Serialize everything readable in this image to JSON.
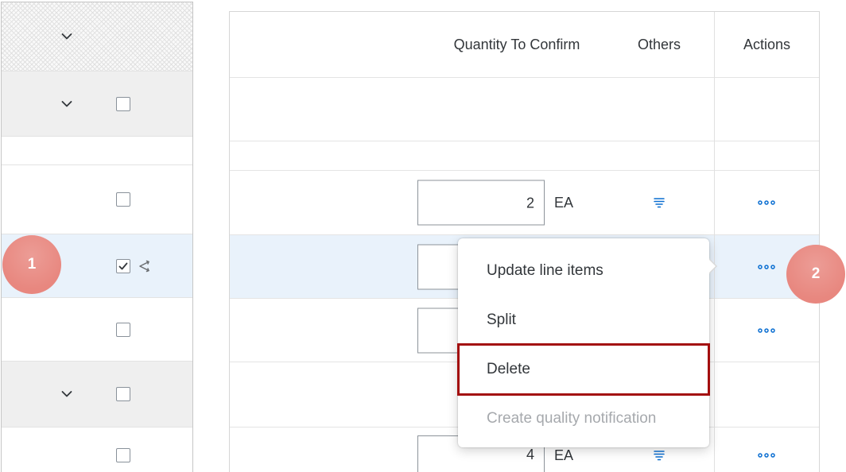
{
  "colors": {
    "accent": "#0a6ed1",
    "callout": "#e8877f",
    "highlight_border": "#a30f0f",
    "selected_row": "#e9f2fb",
    "group_row": "#efefef",
    "disabled_text": "#a6a9ad"
  },
  "callouts": [
    {
      "label": "1"
    },
    {
      "label": "2"
    }
  ],
  "left_table": {
    "header": {
      "expand_icon": "chevron-down-icon"
    },
    "rows": [
      {
        "expand_icon": "chevron-down-icon",
        "checked": false
      },
      {},
      {
        "checked": false
      },
      {
        "checked": true,
        "selected": true,
        "row_icon": "split-icon"
      },
      {
        "checked": false
      },
      {
        "expand_icon": "chevron-down-icon",
        "checked": false
      },
      {
        "checked": false
      }
    ]
  },
  "right_table": {
    "columns": {
      "quantity": "Quantity To Confirm",
      "others": "Others",
      "actions": "Actions"
    },
    "rows": [
      {},
      {},
      {
        "quantity": "2",
        "unit": "EA",
        "others_icon": "filter-icon",
        "actions_icon": "more-icon"
      },
      {
        "selected": true,
        "actions_icon": "more-icon"
      },
      {
        "actions_icon": "more-icon"
      },
      {},
      {
        "quantity": "4",
        "unit": "EA",
        "others_icon": "filter-icon",
        "actions_icon": "more-icon"
      }
    ]
  },
  "context_menu": {
    "items": [
      {
        "label": "Update line items",
        "enabled": true
      },
      {
        "label": "Split",
        "enabled": true
      },
      {
        "label": "Delete",
        "enabled": true,
        "highlighted": true
      },
      {
        "label": "Create quality notification",
        "enabled": false
      }
    ]
  }
}
